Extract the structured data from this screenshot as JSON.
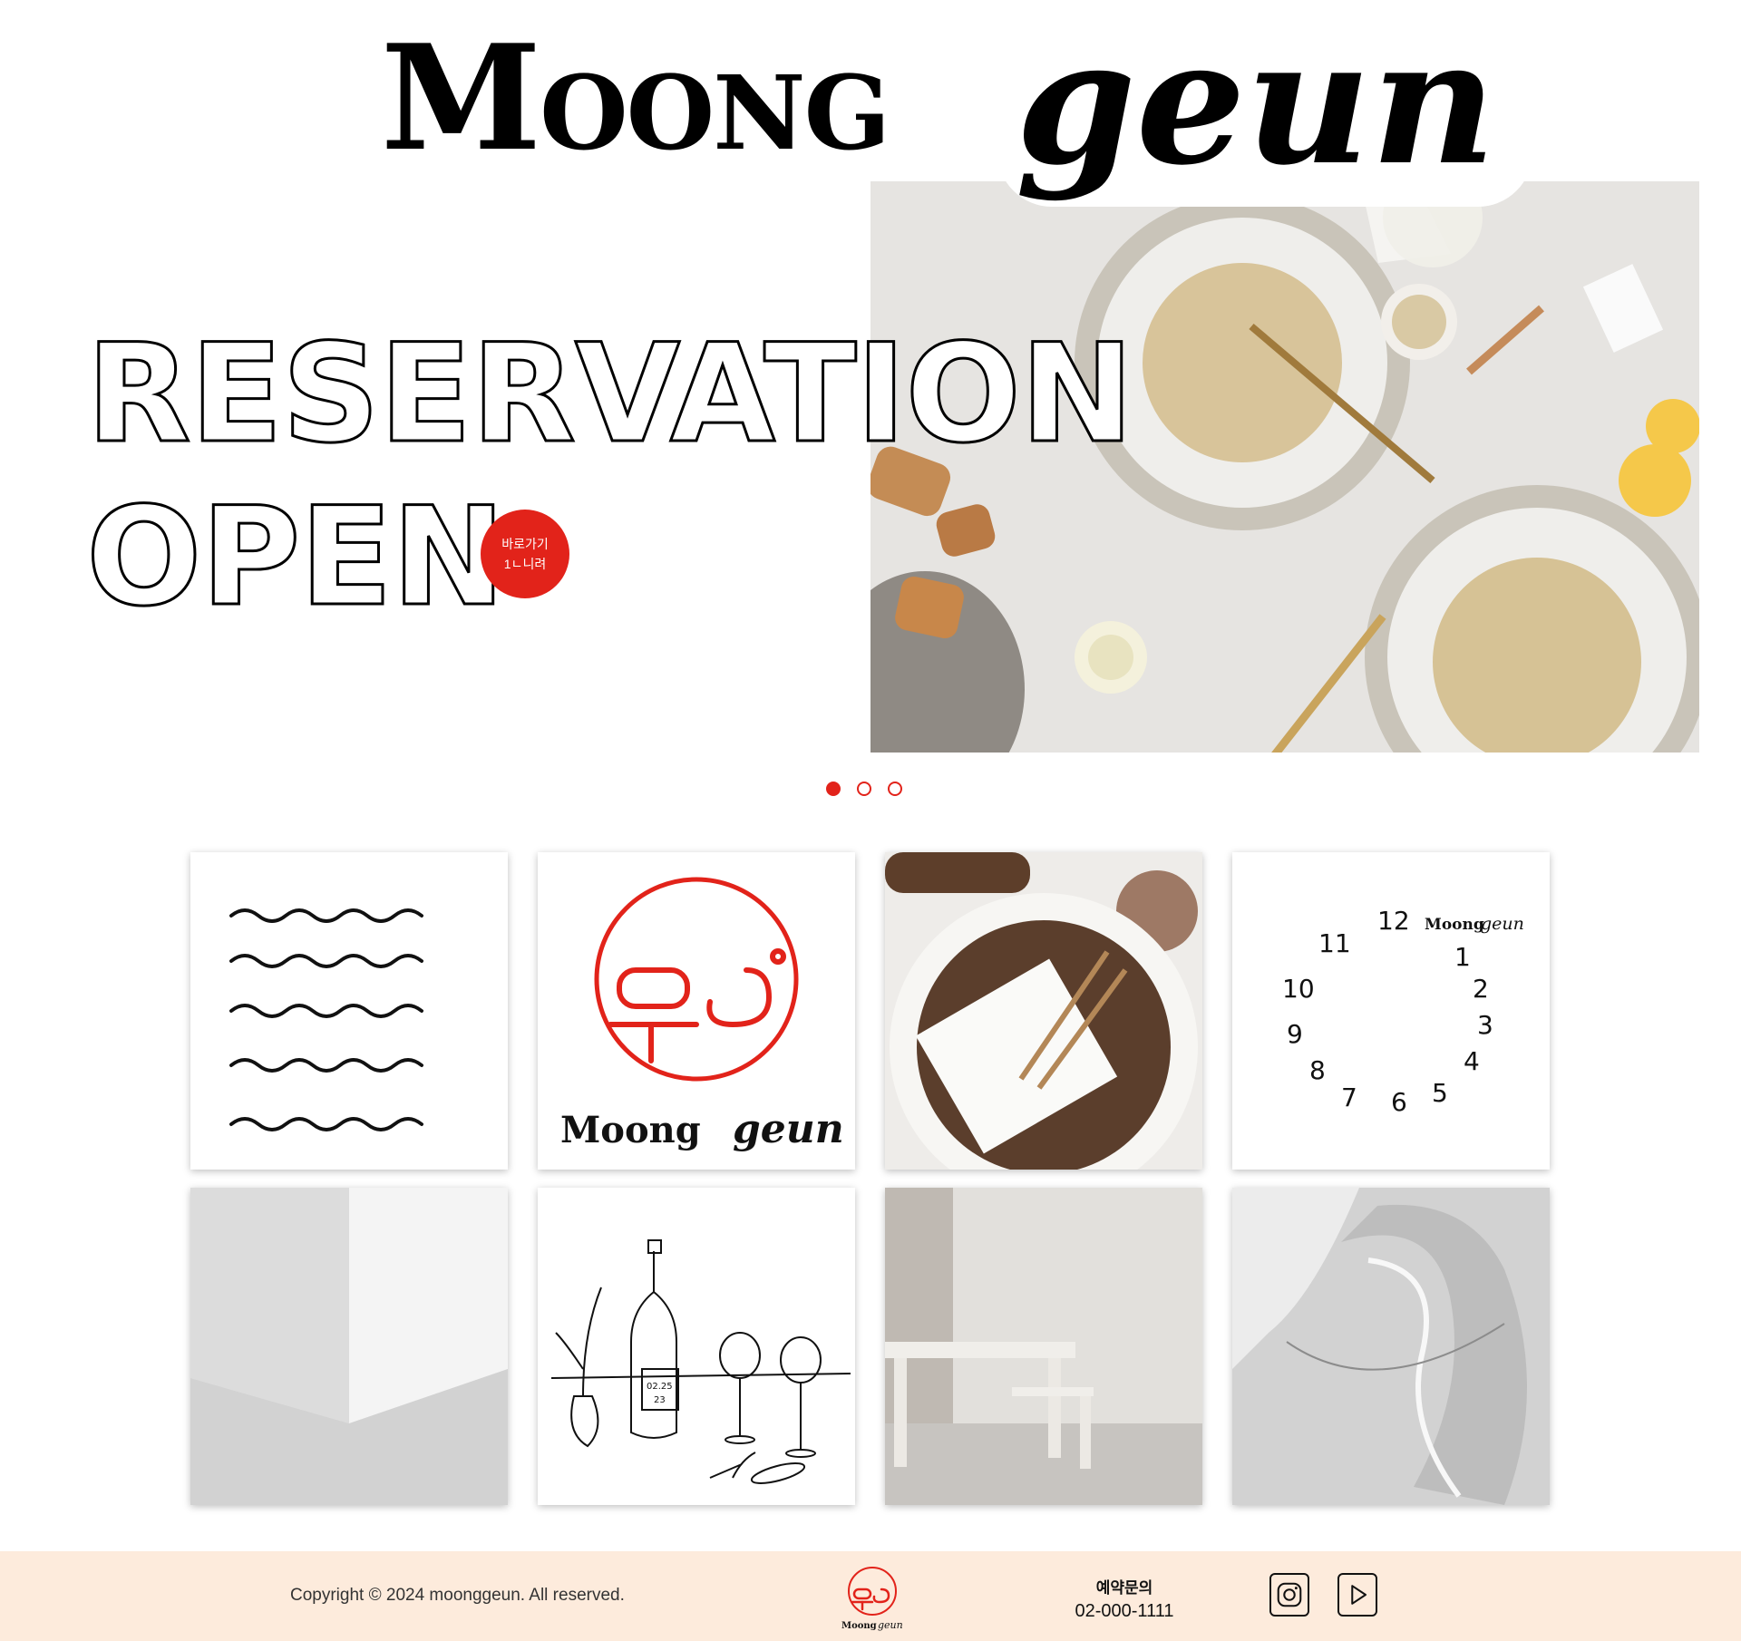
{
  "brand": {
    "moong": "Moong",
    "geun": "geun"
  },
  "hero": {
    "line1": "RESERVATION",
    "line2": "OPEN",
    "badge_line1": "바로가기",
    "badge_line2": "1ㄴ니려"
  },
  "slider": {
    "total": 3,
    "active": 1
  },
  "grid": {
    "tile2_text_moong": "Moong",
    "tile2_text_geun": "geun",
    "tile4_brand_moong": "Moong",
    "tile4_brand_geun": "geun",
    "tile4_numbers": [
      "12",
      "1",
      "2",
      "3",
      "4",
      "5",
      "6",
      "7",
      "8",
      "9",
      "10",
      "11"
    ],
    "tile6_note_line1": "02.25",
    "tile6_note_line2": "23"
  },
  "footer": {
    "copyright": "Copyright © 2024 moonggeun. All reserved.",
    "reservation_title": "예약문의",
    "reservation_phone": "02-000-1111",
    "logo_text_moong": "Moong",
    "logo_text_geun": "geun"
  },
  "colors": {
    "accent": "#e2231a",
    "footer_bg": "#fdebdc"
  },
  "icons": [
    "instagram-icon",
    "youtube-play-icon"
  ]
}
